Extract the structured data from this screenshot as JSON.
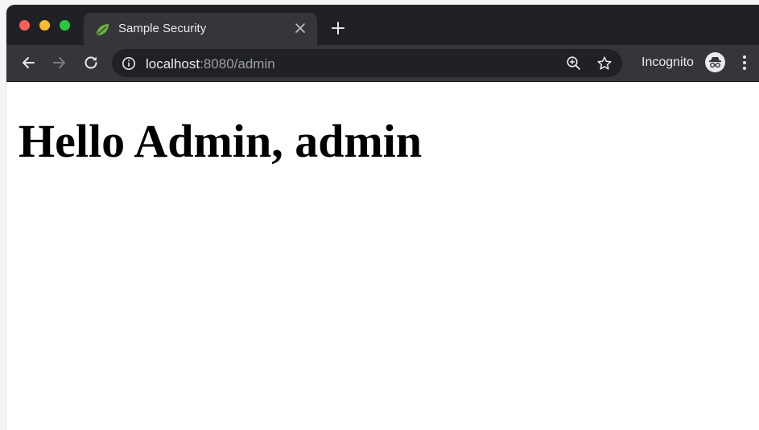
{
  "browser": {
    "tab": {
      "title": "Sample Security",
      "favicon": "spring-leaf-icon"
    },
    "url": {
      "host": "localhost",
      "rest": ":8080/admin"
    },
    "profile_label": "Incognito",
    "colors": {
      "frame": "#202124",
      "toolbar": "#35363a",
      "omnibox": "#202124",
      "close": "#ff5f57",
      "minimize": "#febc2e",
      "maximize": "#28c840",
      "favicon": "#6db33f"
    },
    "icons": [
      "back-arrow-icon",
      "forward-arrow-icon",
      "reload-icon",
      "info-icon",
      "zoom-icon",
      "star-icon",
      "incognito-icon",
      "menu-icon"
    ]
  },
  "page": {
    "heading": "Hello Admin, admin"
  }
}
